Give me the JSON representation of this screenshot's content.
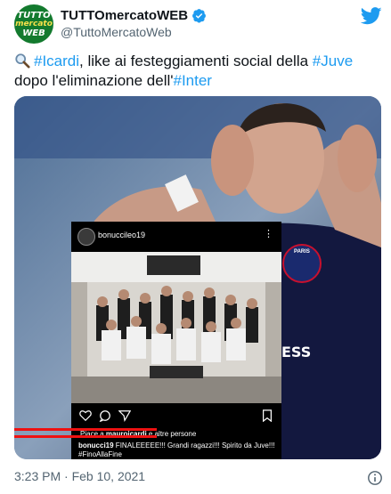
{
  "account": {
    "display_name": "TUTTOmercatoWEB",
    "handle": "@TuttoMercatoWeb",
    "avatar_lines": [
      "TUTTO",
      "mercato",
      "WEB"
    ]
  },
  "tweet": {
    "parts": [
      {
        "text": "#Icardi",
        "tag": true
      },
      {
        "text": ", like ai festeggiamenti social della ",
        "tag": false
      },
      {
        "text": "#Juve",
        "tag": true
      },
      {
        "text": " dopo l'eliminazione dell'",
        "tag": false
      },
      {
        "text": "#Inter",
        "tag": true
      }
    ],
    "timestamp": "3:23 PM · Feb 10, 2021"
  },
  "image": {
    "jersey_text": "ESS",
    "badge_text": "PARIS",
    "instagram": {
      "username": "bonuccileo19",
      "likes_prefix": "Piace a ",
      "likes_user": "mauroicardi",
      "likes_suffix": " e altre persone",
      "caption_user": "bonucci19",
      "caption_text": " FINALEEEEE!!! Grandi ragazzi!!! Spirito da Juve!!!",
      "caption_tag": "#FinoAllaFine"
    }
  },
  "colors": {
    "link": "#1d9bf0",
    "verified": "#1d9bf0",
    "avatar_bg": "#137a2e",
    "highlight": "#e11111"
  },
  "icons": {
    "verified": "verified-badge-icon",
    "brand": "twitter-bird-icon",
    "search": "magnifier-icon",
    "info": "info-icon"
  }
}
